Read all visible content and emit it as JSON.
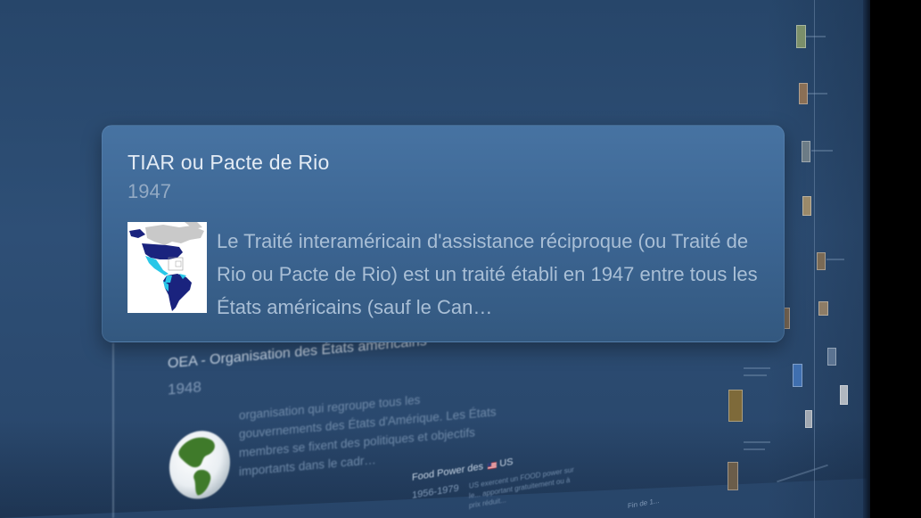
{
  "focused_card": {
    "title": "TIAR ou Pacte de Rio",
    "year": "1947",
    "description": "Le Traité interaméricain d'assistance réciproque (ou Traité de Rio ou Pacte de Rio) est un traité établi en 1947 entre tous les États américains (sauf le Can…",
    "thumbnail_icon": "americas-map-icon"
  },
  "background_card": {
    "title": "OEA - Organisation des États américains",
    "year": "1948",
    "description": "organisation qui regroupe tous les gouvernements des États d'Amérique. Les États membres se fixent des politiques et objectifs importants dans le cadr…",
    "thumbnail_icon": "globe-icon"
  },
  "food_card": {
    "title": "Food Power des",
    "title_suffix": "US",
    "flag_icon": "us-flag-icon",
    "year": "1956-1979",
    "description": "US exercent un FOOD power sur le... apportant gratuitement ou à prix réduit..."
  },
  "fin_label": "Fin de 1...",
  "colors": {
    "wall": "#2e4f76",
    "card_top": "#4773a2",
    "card_bottom": "#33587f",
    "title_text": "#e3ebf4",
    "year_text": "#93aac4",
    "body_text": "#a9bfd6",
    "map_us": "#1a237e",
    "map_latam": "#29c7e8",
    "map_canada": "#c9c9c9"
  }
}
